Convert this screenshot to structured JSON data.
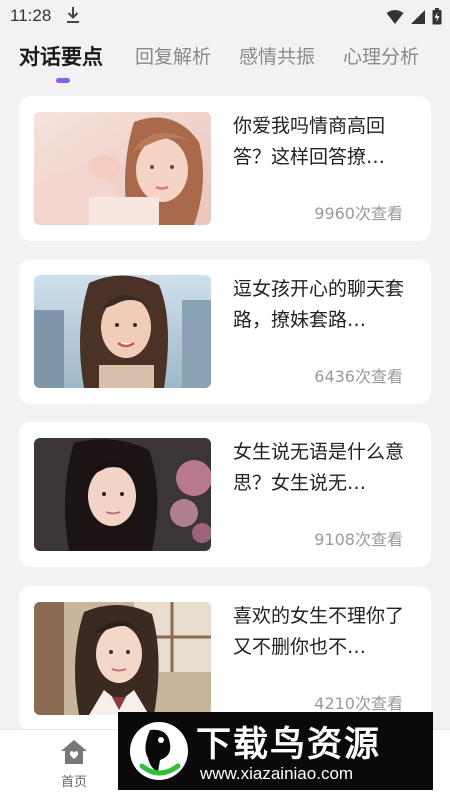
{
  "status_bar": {
    "time": "11:28",
    "icons": [
      "download-icon",
      "wifi-icon",
      "signal-icon",
      "battery-icon"
    ]
  },
  "tabs": [
    {
      "label": "对话要点",
      "active": true
    },
    {
      "label": "回复解析",
      "active": false
    },
    {
      "label": "感情共振",
      "active": false
    },
    {
      "label": "心理分析",
      "active": false
    }
  ],
  "accent_color": "#8b5cf6",
  "articles": [
    {
      "title": "你爱我吗情商高回答？这样回答撩…",
      "views": "9960次查看"
    },
    {
      "title": "逗女孩开心的聊天套路，撩妹套路…",
      "views": "6436次查看"
    },
    {
      "title": "女生说无语是什么意思？女生说无…",
      "views": "9108次查看"
    },
    {
      "title": "喜欢的女生不理你了又不删你也不…",
      "views": "4210次查看"
    }
  ],
  "bottom_nav": {
    "home_label": "首页",
    "home_icon": "home-icon"
  },
  "watermark": {
    "title": "下载鸟资源",
    "url": "www.xiazainiao.com"
  }
}
